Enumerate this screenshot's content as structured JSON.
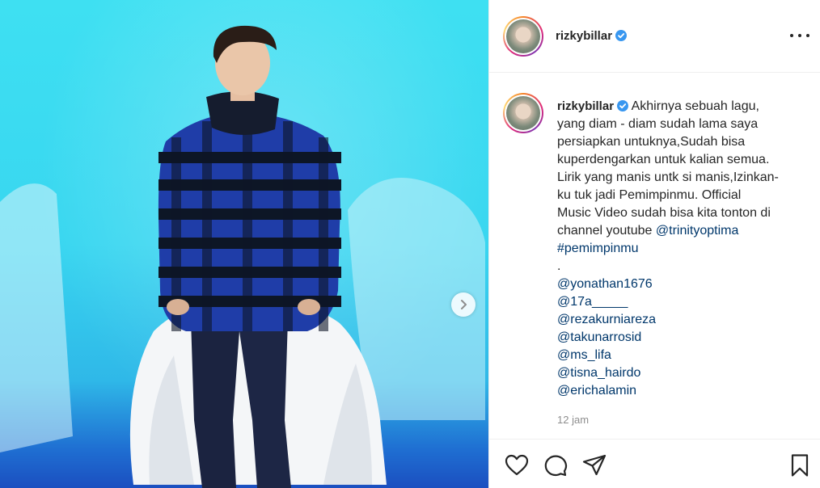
{
  "post": {
    "media": {
      "next_icon": "chevron-right-icon"
    },
    "header": {
      "username": "rizkybillar",
      "verified_icon": "verified-badge-icon",
      "more_icon": "more-options-icon"
    },
    "caption": {
      "username": "rizkybillar",
      "lines": [
        "Akhirnya sebuah lagu,",
        "yang diam - diam sudah lama saya",
        "persiapkan untuknya,Sudah bisa",
        "kuperdengarkan untuk kalian semua.",
        "Lirik yang manis untk si manis,Izinkan-",
        "ku tuk jadi Pemimpinmu. Official",
        "Music Video sudah bisa kita tonton di"
      ],
      "channel_prefix": "channel youtube ",
      "mention_main": "@trinityoptima",
      "hashtag": "#pemimpinmu",
      "dot": ".",
      "mentions": [
        "@yonathan1676",
        "@17a_____",
        "@rezakurniareza",
        "@takunarrosid",
        "@ms_lifa",
        "@tisna_hairdo",
        "@erichalamin"
      ],
      "timestamp": "12 jam"
    },
    "actions": {
      "like_icon": "heart-icon",
      "comment_icon": "comment-icon",
      "share_icon": "share-icon",
      "save_icon": "bookmark-icon"
    },
    "colors": {
      "link": "#00376b",
      "muted": "#8e8e8e",
      "verified": "#3897f0",
      "backdrop": "#3ee0f2",
      "floor": "#1b4fc0"
    }
  }
}
